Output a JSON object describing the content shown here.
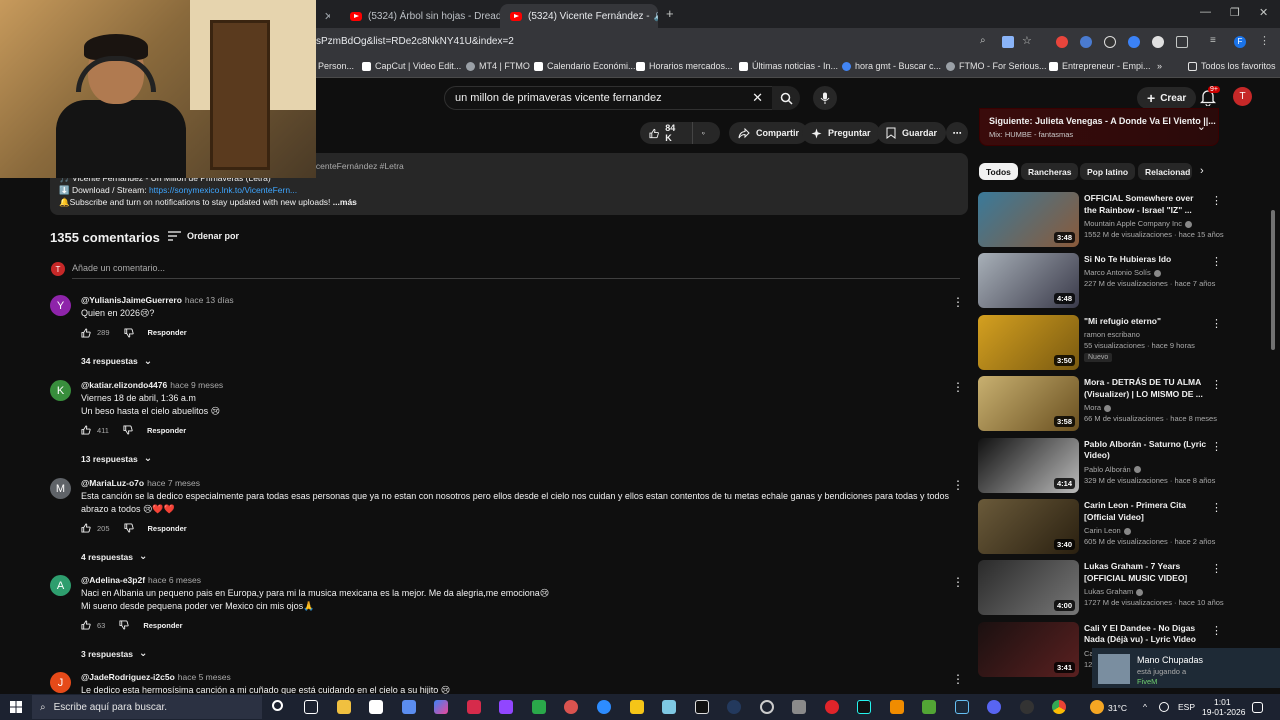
{
  "browser": {
    "tabs": [
      {
        "title": "(5324) Árbol sin hojas - Dread"
      },
      {
        "title": "(5324) Vicente Fernández - "
      }
    ],
    "url": "sPzmBdOg&list=RDe2c8NkNY41U&index=2",
    "bookmarks": [
      {
        "label": "Person..."
      },
      {
        "label": "CapCut | Video Edit..."
      },
      {
        "label": "MT4 | FTMO"
      },
      {
        "label": "Calendario Económi..."
      },
      {
        "label": "Horarios mercados..."
      },
      {
        "label": "Últimas noticias - In..."
      },
      {
        "label": "hora gmt - Buscar c..."
      },
      {
        "label": "FTMO - For Serious..."
      },
      {
        "label": "Entrepreneur - Empi..."
      },
      {
        "label": "Todos los favoritos"
      }
    ]
  },
  "youtube": {
    "search_value": "un millon de primaveras vicente fernandez",
    "create_label": "Crear",
    "notif_count": "9+",
    "user_initial": "T",
    "actions": {
      "likes": "84 K",
      "share": "Compartir",
      "ask": "Preguntar",
      "save": "Guardar"
    },
    "description": {
      "hashtags": "icenteFernández #Letra",
      "line1": "🎵 Vicente Fernández - Un Millón de Primaveras (Letra)",
      "line2_prefix": "⬇️ Download / Stream: ",
      "line2_link": "https://sonymexico.lnk.to/VicenteFern...",
      "line3": "🔔Subscribe and turn on notifications to stay updated with new uploads!",
      "more": "...más"
    },
    "comments_header": {
      "count": "1355 comentarios",
      "sort": "Ordenar por",
      "add_placeholder": "Añade un comentario..."
    },
    "comments": [
      {
        "initial": "Y",
        "color": "#8e24aa",
        "author": "@YulianisJaimeGuerrero",
        "time": "hace 13 días",
        "text": "Quien en 2026😢?",
        "likes": "289",
        "reply": "Responder",
        "replies": "34 respuestas"
      },
      {
        "initial": "K",
        "color": "#388e3c",
        "author": "@katiar.elizondo4476",
        "time": "hace 9 meses",
        "text": "Viernes 18 de abril, 1:36 a.m\nUn beso hasta el cielo abuelitos 😢",
        "likes": "411",
        "reply": "Responder",
        "replies": "13 respuestas"
      },
      {
        "initial": "M",
        "color": "#5f6368",
        "author": "@MariaLuz-o7o",
        "time": "hace 7 meses",
        "text": "Esta canción  se la dedico especialmente  para todas esas personas  que ya no estan con nosotros pero ellos desde el cielo nos cuidan y ellos estan contentos  de tu metas echale ganas y bendiciones  para todas y todos abrazo a todos 😢❤️❤️",
        "likes": "205",
        "reply": "Responder",
        "replies": "4 respuestas"
      },
      {
        "initial": "A",
        "color": "#2e9e6e",
        "author": "@Adelina-e3p2f",
        "time": "hace 6 meses",
        "text": "Naci en Albania un pequeno pais en Europa,y para mi la musica mexicana es la mejor. Me da alegria,me emociona😢\nMi sueno desde pequena poder ver Mexico cin mis ojos🙏",
        "likes": "63",
        "reply": "Responder",
        "replies": "3 respuestas"
      },
      {
        "initial": "J",
        "color": "#e64a19",
        "author": "@JadeRodriguez-i2c5o",
        "time": "hace 5 meses",
        "text": "Le dedico esta hermosísima canción a mi cuñado que está cuidando en el cielo a su hijito 😢",
        "likes": "",
        "reply": "",
        "replies": ""
      }
    ],
    "next": {
      "title": "Siguiente: Julieta Venegas - A Donde Va El Viento ||...",
      "sub": "Mix: HUMBE - fantasmas"
    },
    "chips": [
      "Todos",
      "Rancheras",
      "Pop latino",
      "Relacionad"
    ],
    "recommendations": [
      {
        "title": "OFFICIAL Somewhere over the Rainbow - Israel \"IZ\" ...",
        "channel": "Mountain Apple Company Inc",
        "meta": "1552 M de visualizaciones · hace 15 años",
        "duration": "3:48",
        "verified": true,
        "badge": "",
        "thumb": [
          "#3a7a9a",
          "#8a5a3a"
        ]
      },
      {
        "title": "Si No Te Hubieras Ido",
        "channel": "Marco Antonio Solís",
        "meta": "227 M de visualizaciones · hace 7 años",
        "duration": "4:48",
        "verified": true,
        "badge": "",
        "thumb": [
          "#a8b0b8",
          "#3a3a4a"
        ]
      },
      {
        "title": "\"Mi refugio eterno\"",
        "channel": "ramon escribano",
        "meta": "55 visualizaciones · hace 9 horas",
        "duration": "3:50",
        "verified": false,
        "badge": "Nuevo",
        "thumb": [
          "#d4a020",
          "#7a5a10"
        ]
      },
      {
        "title": "Mora - DETRÁS DE TU ALMA (Visualizer) | LO MISMO DE ...",
        "channel": "Mora",
        "meta": "66 M de visualizaciones · hace 8 meses",
        "duration": "3:58",
        "verified": true,
        "badge": "",
        "thumb": [
          "#c8b070",
          "#6a5020"
        ]
      },
      {
        "title": "Pablo Alborán - Saturno (Lyric Video)",
        "channel": "Pablo Alborán",
        "meta": "329 M de visualizaciones · hace 8 años",
        "duration": "4:14",
        "verified": true,
        "badge": "",
        "thumb": [
          "#111111",
          "#bbbbbb"
        ]
      },
      {
        "title": "Carin Leon - Primera Cita [Official Video]",
        "channel": "Carin Leon",
        "meta": "605 M de visualizaciones · hace 2 años",
        "duration": "3:40",
        "verified": true,
        "badge": "",
        "thumb": [
          "#6a5a3a",
          "#2a2010"
        ]
      },
      {
        "title": "Lukas Graham - 7 Years [OFFICIAL MUSIC VIDEO]",
        "channel": "Lukas Graham",
        "meta": "1727 M de visualizaciones · hace 10 años",
        "duration": "4:00",
        "verified": true,
        "badge": "",
        "thumb": [
          "#2a2a2a",
          "#777777"
        ]
      },
      {
        "title": "Cali Y El Dandee - No Digas Nada (Déjà vu) - Lyric Video",
        "channel": "Ca",
        "meta": "12",
        "duration": "3:41",
        "verified": false,
        "badge": "",
        "thumb": [
          "#1a1010",
          "#5a2020"
        ]
      }
    ],
    "toast": {
      "title": "Mano Chupadas",
      "sub": "está jugando a",
      "game": "FiveM"
    }
  },
  "taskbar": {
    "search_placeholder": "Escribe aquí para buscar.",
    "temperature": "31°C",
    "language": "ESP",
    "time": "1:01",
    "date": "19-01-2026"
  }
}
